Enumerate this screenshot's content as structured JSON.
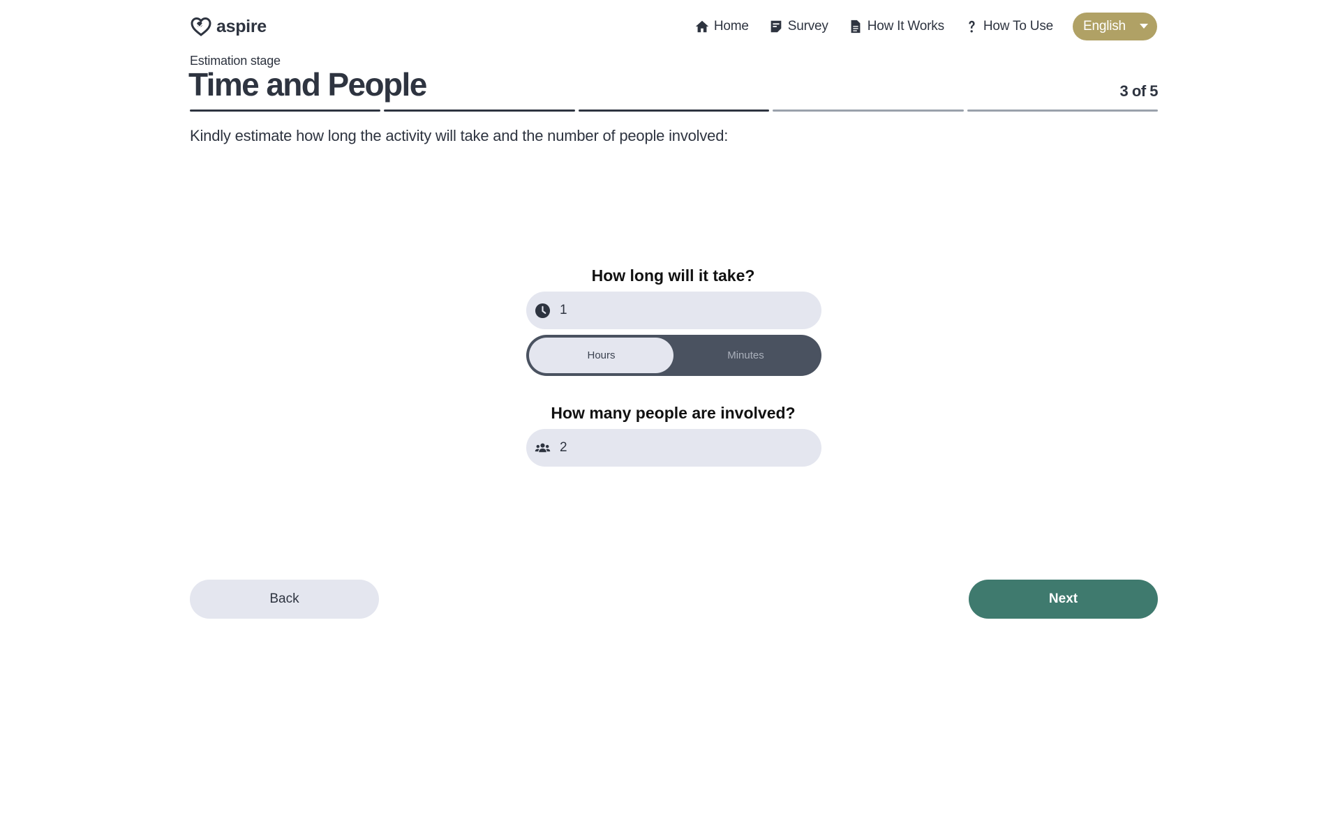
{
  "brand": {
    "name": "aspire",
    "icon": "heart-logo-icon"
  },
  "nav": {
    "items": [
      {
        "label": "Home",
        "icon": "home-icon"
      },
      {
        "label": "Survey",
        "icon": "survey-icon"
      },
      {
        "label": "How It Works",
        "icon": "document-icon"
      },
      {
        "label": "How To Use",
        "icon": "question-icon"
      }
    ],
    "language": {
      "selected": "English",
      "icon": "caret-down-icon"
    }
  },
  "stage": {
    "label": "Estimation stage",
    "title": "Time and People",
    "step_text": "3 of 5",
    "progress": {
      "current": 3,
      "total": 5
    }
  },
  "instruction": "Kindly estimate how long the activity will take and the number of people involved:",
  "time_question": {
    "label": "How long will it take?",
    "value": "1",
    "icon": "clock-icon",
    "units": [
      "Hours",
      "Minutes"
    ],
    "selected_unit": "Hours"
  },
  "people_question": {
    "label": "How many people are involved?",
    "value": "2",
    "icon": "people-icon"
  },
  "buttons": {
    "back": "Back",
    "next": "Next"
  },
  "colors": {
    "text": "#2e3440",
    "language_bg": "#b0a165",
    "field_bg": "#e4e6ef",
    "toggle_bg": "#4a5260",
    "next_bg": "#3f7a6e"
  }
}
